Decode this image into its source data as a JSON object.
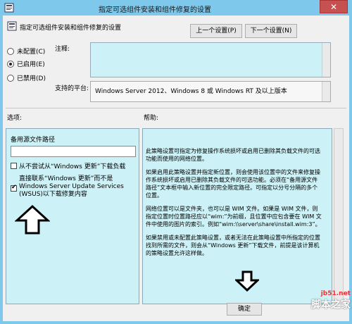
{
  "window": {
    "title": "指定可选组件安装和组件修复的设置",
    "close_glyph": "✕"
  },
  "header": {
    "policy_title": "指定可选组件安装和组件修复的设置",
    "prev_button": "上一个设置(P)",
    "next_button": "下一个设置(N)"
  },
  "state": {
    "not_configured": "未配置(C)",
    "enabled": "已启用(E)",
    "disabled": "已禁用(D)",
    "selected": "enabled"
  },
  "comment": {
    "label": "注释:",
    "value": ""
  },
  "platform": {
    "label": "支持的平台:",
    "value": "Windows Server 2012、Windows 8 或 Windows RT 及以上版本"
  },
  "sections": {
    "options_label": "选项:",
    "help_label": "帮助:"
  },
  "options": {
    "alt_source_label": "备用源文件路径",
    "alt_source_value": "",
    "never_wu_label": "从不尝试从“Windows 更新”下载负载",
    "never_wu_checked": false,
    "contact_wu_label": "直接联系“Windows 更新”而不是 Windows Server Update Services (WSUS)以下载修复内容",
    "contact_wu_checked": true
  },
  "help": {
    "paragraphs": [
      "此策略设置可指定为修复操作系统损坏或启用已删除其负载文件的可选功能而使用的网络位置。",
      "如果启用此策略设置并指定新位置，则会使用该位置中的文件来修复操作系统损坏或启用已删除其负载文件的可选功能。必须在“备用源文件路径”文本框中输入新位置的完全限定路径。可指定以分号分隔的多个位置。",
      "网络位置可以是文件夹，也可以是 WIM 文件。如果是 WIM 文件，则指定位置时位置路径应以“wim:”为前缀，且位置中应包含要在 WIM 文件中使用的图片的索引。例如“wim:\\\\server\\share\\install.wim:3”。",
      "如果禁用或未配置此策略设置，或者无法在此策略设置中所指定的位置找到所需的文件，则会从“Windows 更新”下载文件，前提是该计算机的策略设置允许这样做。"
    ]
  },
  "footer": {
    "ok_button": "确定"
  },
  "watermark": {
    "site": "jb51.net",
    "name": "脚本之家"
  },
  "colors": {
    "titlebar": "#7ec8ec",
    "panel": "#ccf2f7",
    "close": "#c75050"
  }
}
